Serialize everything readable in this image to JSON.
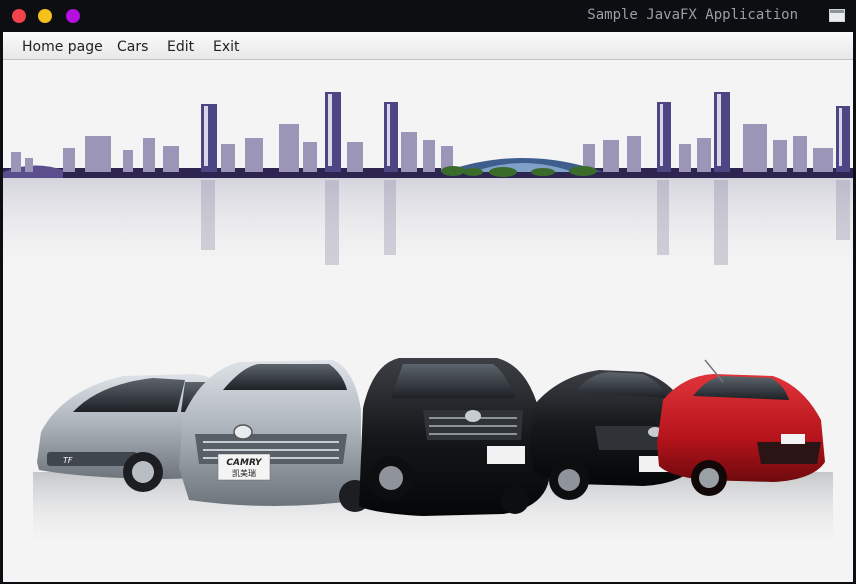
{
  "window": {
    "title": "Sample JavaFX Application"
  },
  "menubar": {
    "items": [
      "Home page",
      "Cars",
      "Edit",
      "Exit"
    ]
  },
  "banner": {
    "car_labels": [
      "CAMRY",
      "凯美瑞"
    ]
  },
  "colors": {
    "close": "#f0434a",
    "minimize": "#f4c21a",
    "maximize": "#b40fe0",
    "titlebar_bg": "#0c0e12",
    "content_bg": "#f4f4f4"
  },
  "icons": [
    "close-icon",
    "minimize-icon",
    "maximize-icon",
    "window-icon"
  ]
}
